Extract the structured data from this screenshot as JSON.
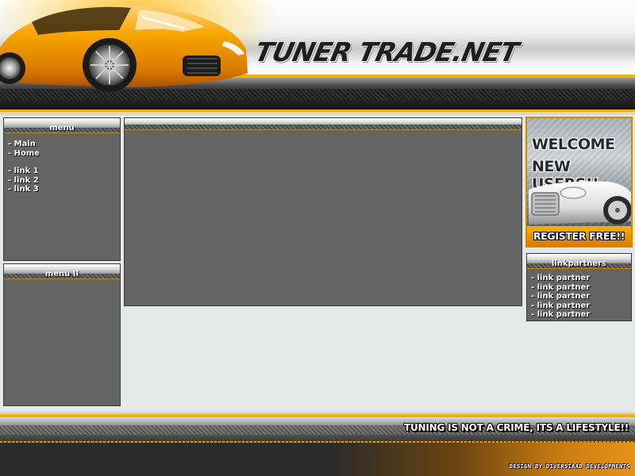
{
  "header": {
    "logo_text": "TUNER TRADE.NET",
    "accent_color": "#f0b400",
    "car_color": "#f29a00"
  },
  "menu": {
    "title": "menu",
    "items_primary": [
      "- Main",
      "- Home"
    ],
    "items_links": [
      "- link 1",
      "- link 2",
      "- link 3"
    ]
  },
  "menu2": {
    "title": "menu II"
  },
  "content": {},
  "banner": {
    "line1": "WELCOME",
    "line2": "NEW USERS!!",
    "register": "REGISTER FREE!!"
  },
  "linkpartners": {
    "title": "linkpartners",
    "items": [
      "- link partner",
      "- link partner",
      "- link partner",
      "- link partner",
      "- link partner"
    ]
  },
  "footer": {
    "slogan": "TUNING IS NOT A CRIME, ITS A LIFESTYLE!!",
    "credit": "DESIGN BY DIVERSIAAD DEVELOPMENTS"
  }
}
